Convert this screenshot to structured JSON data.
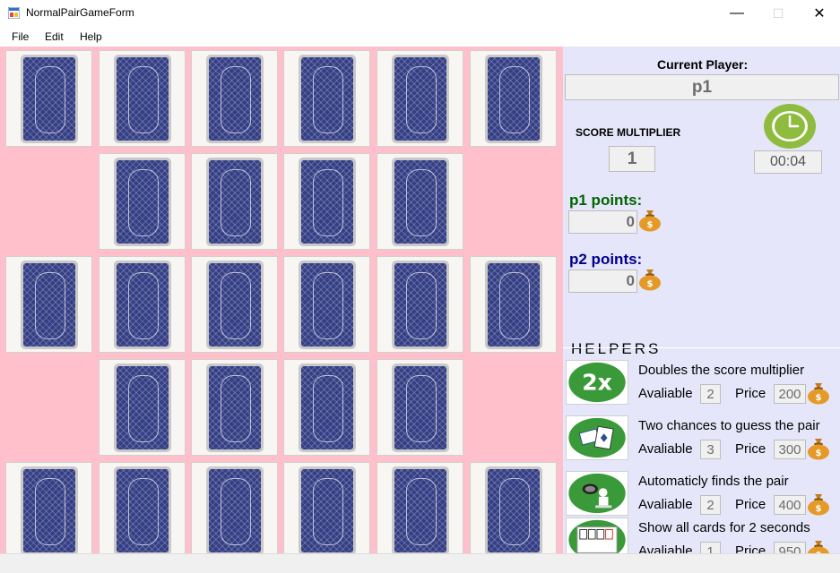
{
  "window": {
    "title": "NormalPairGameForm",
    "controls": {
      "minimize": "—",
      "maximize": "☐",
      "close": "✕"
    }
  },
  "menu": {
    "items": [
      "File",
      "Edit",
      "Help"
    ]
  },
  "board": {
    "rows": [
      [
        true,
        true,
        true,
        true,
        true,
        true
      ],
      [
        false,
        true,
        true,
        true,
        true,
        false
      ],
      [
        true,
        true,
        true,
        true,
        true,
        true
      ],
      [
        false,
        true,
        true,
        true,
        true,
        false
      ],
      [
        true,
        true,
        true,
        true,
        true,
        true
      ]
    ]
  },
  "panel": {
    "current_player_label": "Current Player:",
    "current_player": "p1",
    "score_multiplier_label": "SCORE MULTIPLIER",
    "score_multiplier": "1",
    "timer": "00:04",
    "players": [
      {
        "label": "p1 points:",
        "points": "0",
        "color": "#006400"
      },
      {
        "label": "p2 points:",
        "points": "0",
        "color": "#00008b"
      }
    ],
    "helpers_title": "HELPERS",
    "available_label": "Avaliable",
    "price_label": "Price",
    "helpers": [
      {
        "icon": "double-multiplier-icon",
        "description": "Doubles the score multiplier",
        "available": "2",
        "price": "200"
      },
      {
        "icon": "two-chances-icon",
        "description": "Two chances to guess the pair",
        "available": "3",
        "price": "300"
      },
      {
        "icon": "find-pair-icon",
        "description": "Automaticly finds the pair",
        "available": "2",
        "price": "400"
      },
      {
        "icon": "show-all-cards-icon",
        "description": "Show all cards for 2 seconds",
        "available": "1",
        "price": "950"
      }
    ]
  },
  "colors": {
    "board_bg": "#ffc0cb",
    "panel_bg": "#e6e6fa",
    "card_back": "#343e84",
    "helper_icon_green": "#3a9a3a",
    "clock_green": "#8fbc3f"
  }
}
